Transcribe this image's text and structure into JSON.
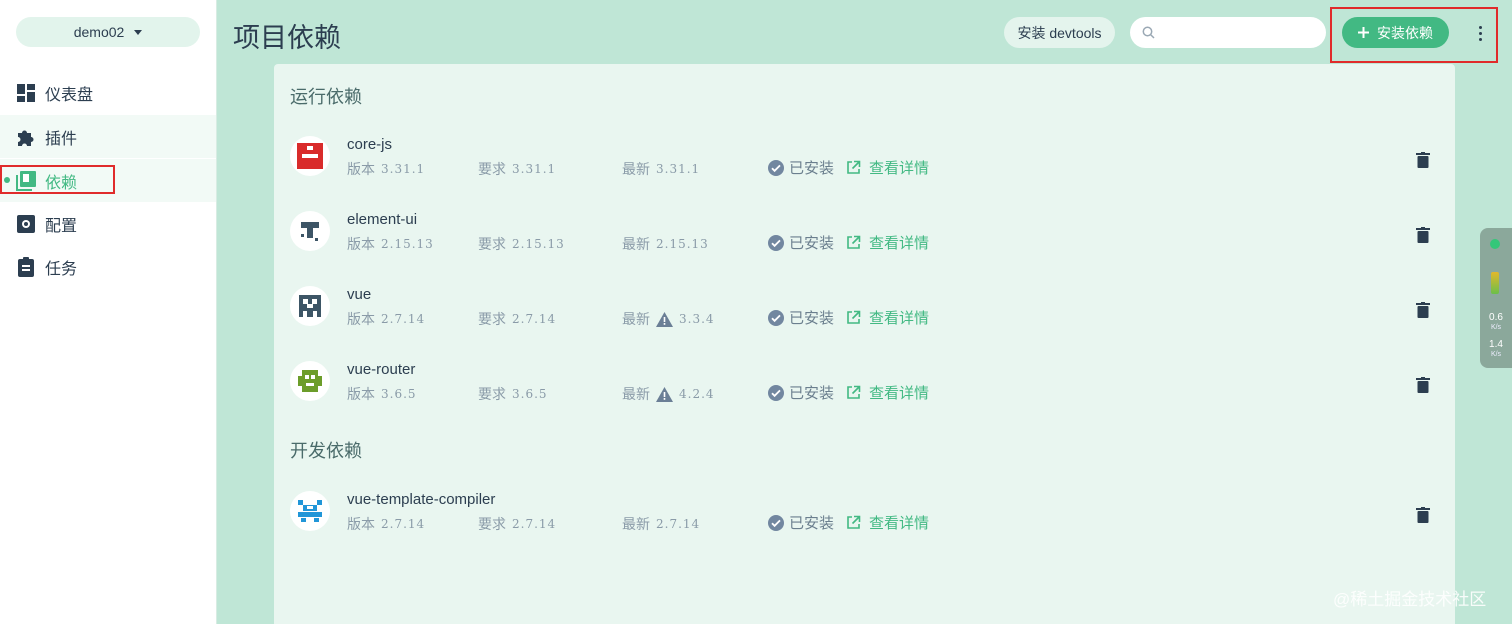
{
  "project": {
    "name": "demo02"
  },
  "sidebar": {
    "items": [
      {
        "label": "仪表盘",
        "icon": "dashboard-icon"
      },
      {
        "label": "插件",
        "icon": "puzzle-icon"
      },
      {
        "label": "依赖",
        "icon": "library-icon",
        "active": true
      },
      {
        "label": "配置",
        "icon": "settings-icon"
      },
      {
        "label": "任务",
        "icon": "clipboard-icon"
      }
    ]
  },
  "header": {
    "title": "项目依赖",
    "devtools_label": "安装 devtools",
    "search_placeholder": "",
    "install_label": "安装依赖"
  },
  "sections": {
    "runtime_title": "运行依赖",
    "dev_title": "开发依赖"
  },
  "labels": {
    "version": "版本",
    "required": "要求",
    "latest": "最新",
    "installed": "已安装",
    "details": "查看详情"
  },
  "dependencies": [
    {
      "name": "core-js",
      "version": "3.31.1",
      "required": "3.31.1",
      "latest": "3.31.1",
      "latest_warning": false
    },
    {
      "name": "element-ui",
      "version": "2.15.13",
      "required": "2.15.13",
      "latest": "2.15.13",
      "latest_warning": false
    },
    {
      "name": "vue",
      "version": "2.7.14",
      "required": "2.7.14",
      "latest": "3.3.4",
      "latest_warning": true
    },
    {
      "name": "vue-router",
      "version": "3.6.5",
      "required": "3.6.5",
      "latest": "4.2.4",
      "latest_warning": true
    }
  ],
  "dev_dependencies": [
    {
      "name": "vue-template-compiler",
      "version": "2.7.14",
      "required": "2.7.14",
      "latest": "2.7.14",
      "latest_warning": false
    }
  ],
  "widget": {
    "up": "0.6",
    "down": "1.4",
    "unit": "K/s"
  },
  "watermark": "@稀土掘金技术社区",
  "colors": {
    "accent": "#42b983",
    "background": "#bfe6d6",
    "panel": "#e9f6f0",
    "highlight_box": "#e02b2b"
  }
}
